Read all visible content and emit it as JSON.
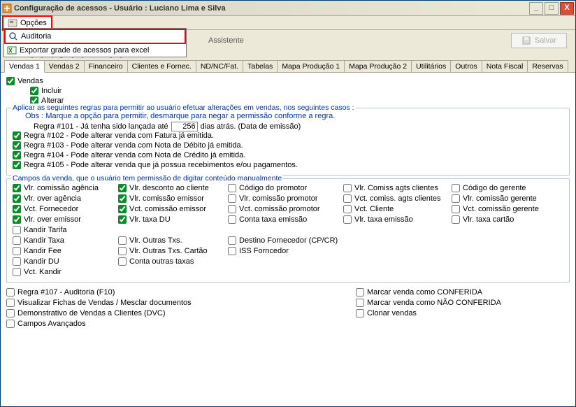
{
  "window": {
    "title": "Configuração de acessos - Usuário : Luciano Lima e Silva"
  },
  "menu": {
    "opcoes": "Opções"
  },
  "dropdown": {
    "auditoria": "Auditoria",
    "exportar": "Exportar grade de acessos para excel"
  },
  "toolbar": {
    "assistente": "Assistente",
    "salvar": "Salvar"
  },
  "hint": "Incluir [F5]· Apagar [F4]· Alterar [F3]",
  "tabs": [
    "Vendas 1",
    "Vendas 2",
    "Financeiro",
    "Clientes e Fornec.",
    "ND/NC/Fat.",
    "Tabelas",
    "Mapa Produção 1",
    "Mapa Produção 2",
    "Utilitários",
    "Outros",
    "Nota Fiscal",
    "Reservas"
  ],
  "vendas": {
    "root": "Vendas",
    "incluir": "Incluir",
    "alterar": "Alterar"
  },
  "rulesBlock": {
    "legend": "Aplicar as seguintes regras para permitir ao usuário efetuar alterações em vendas, nos seguintes casos :",
    "obs": "Obs : Marque a opção para permitir, desmarque para negar a permissão conforme a regra.",
    "rule101a": "Regra #101 - Já tenha sido lançada até",
    "rule101_value": "256",
    "rule101b": "dias atrás. (Data de emissão)",
    "r102": "Regra #102 - Pode alterar venda com Fatura já emitida.",
    "r103": "Regra #103 - Pode alterar venda com Nota de Débito já emitida.",
    "r104": "Regra #104 - Pode alterar venda com Nota de Crédito já emitida.",
    "r105": "Regra #105 - Pode alterar venda que já possua recebimentos e/ou pagamentos."
  },
  "fieldsBlock": {
    "legend": "Campos da venda, que o usuário tem permissão de digitar conteúdo manualmente",
    "c1": [
      "Vlr. comissão agência",
      "Vlr. over agência",
      "Vct. Fornecedor",
      "Vlr. over emissor",
      "Kandir Tarifa",
      "Kandir Taxa",
      "Kandir Fee",
      "Kandir DU",
      "Vct. Kandir"
    ],
    "c2": [
      "Vlr. desconto ao cliente",
      "Vlr. comissão emissor",
      "Vct. comissão emissor",
      "Vlr. taxa DU",
      "",
      "Vlr. Outras Txs.",
      "Vlr. Outras Txs. Cartão",
      "Conta outras taxas"
    ],
    "c3": [
      "Código do promotor",
      "Vlr. comissão promotor",
      "Vct. comissão promotor",
      "Conta taxa emissão",
      "",
      "Destino Fornecedor (CP/CR)",
      "ISS Forncedor"
    ],
    "c4": [
      "Vlr. Comiss agts clientes",
      "Vct. comiss. agts clientes",
      "Vct. Cliente",
      "Vlr. taxa emissão"
    ],
    "c5": [
      "Código do gerente",
      "Vlr. comissão gerente",
      "Vct. comissão gerente",
      "Vlr. taxa cartão"
    ]
  },
  "bottomLeft": [
    "Regra #107 - Auditoria (F10)",
    "Visualizar Fichas de Vendas / Mesclar documentos",
    "Demonstrativo de Vendas a Clientes (DVC)",
    "Campos Avançados"
  ],
  "bottomRight": [
    "Marcar venda como CONFERIDA",
    "Marcar venda como NÃO CONFERIDA",
    "Clonar vendas"
  ]
}
